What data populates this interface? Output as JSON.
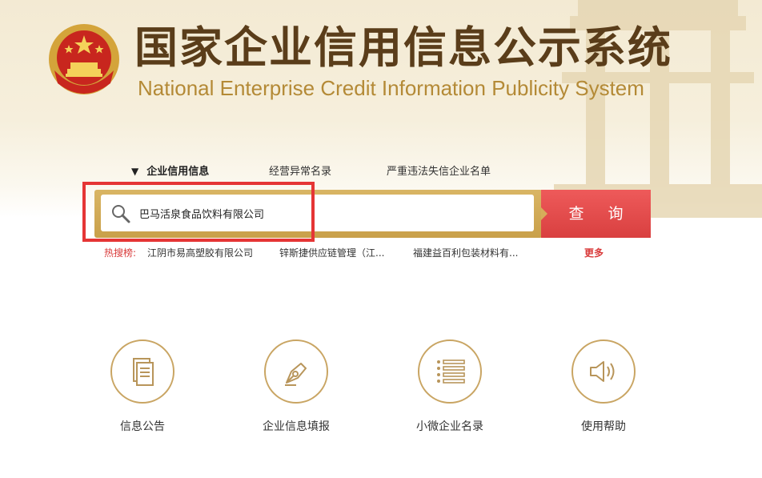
{
  "header": {
    "title_cn": "国家企业信用信息公示系统",
    "title_en": "National Enterprise Credit Information Publicity System"
  },
  "tabs": [
    {
      "label": "企业信用信息",
      "active": true
    },
    {
      "label": "经营异常名录",
      "active": false
    },
    {
      "label": "严重违法失信企业名单",
      "active": false
    }
  ],
  "search": {
    "value": "巴马活泉食品饮料有限公司",
    "button_label": "查 询"
  },
  "hot_search": {
    "label": "热搜榜:",
    "items": [
      "江阴市易高塑胶有限公司",
      "锌斯捷供应链管理（江...",
      "福建益百利包装材料有..."
    ],
    "more_label": "更多"
  },
  "features": [
    {
      "label": "信息公告",
      "icon": "document-icon"
    },
    {
      "label": "企业信息填报",
      "icon": "pen-nib-icon"
    },
    {
      "label": "小微企业名录",
      "icon": "list-icon"
    },
    {
      "label": "使用帮助",
      "icon": "speaker-icon"
    }
  ],
  "colors": {
    "brand_brown": "#5a3d1a",
    "gold": "#c9a563",
    "search_button": "#e04848",
    "highlight_red": "#e53535",
    "hot_label": "#d93a3a"
  }
}
